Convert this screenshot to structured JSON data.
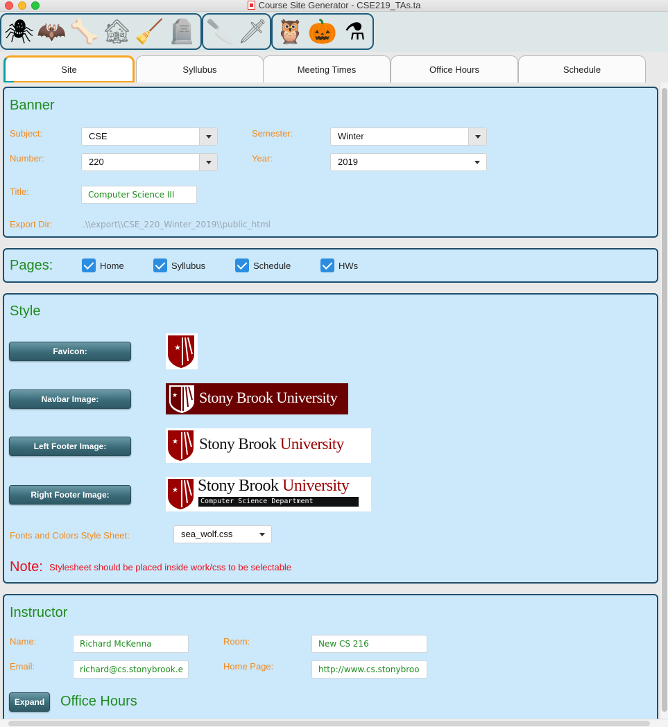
{
  "window": {
    "title": "Course Site Generator - CSE219_TAs.ta"
  },
  "toolbar": {
    "group1": [
      {
        "icon": "spider-icon",
        "glyph": "🕷"
      },
      {
        "icon": "bat-icon",
        "glyph": "🦇"
      },
      {
        "icon": "bones-icon",
        "glyph": "🦴"
      },
      {
        "icon": "haunted-house-icon",
        "glyph": "🏚"
      },
      {
        "icon": "magic-broom-icon",
        "glyph": "🧹"
      },
      {
        "icon": "tombstone-icon",
        "glyph": "🪦"
      }
    ],
    "group2": [
      {
        "icon": "cleaver-icon",
        "glyph": "🔪"
      },
      {
        "icon": "bloody-knife-icon",
        "glyph": "🗡"
      }
    ],
    "group3": [
      {
        "icon": "owl-icon",
        "glyph": "🦉"
      },
      {
        "icon": "pumpkin-icon",
        "glyph": "🎃"
      },
      {
        "icon": "cauldron-icon",
        "glyph": "⚗"
      }
    ]
  },
  "tabs": [
    "Site",
    "Syllubus",
    "Meeting Times",
    "Office Hours",
    "Schedule"
  ],
  "banner": {
    "title": "Banner",
    "subject_label": "Subject:",
    "subject_value": "CSE",
    "semester_label": "Semester:",
    "semester_value": "Winter",
    "number_label": "Number:",
    "number_value": "220",
    "year_label": "Year:",
    "year_value": "2019",
    "title_label": "Title:",
    "title_value": "Computer Science III",
    "export_label": "Export Dir:",
    "export_value": ".\\\\export\\\\CSE_220_Winter_2019\\\\public_html"
  },
  "pages": {
    "title": "Pages:",
    "items": [
      "Home",
      "Syllubus",
      "Schedule",
      "HWs"
    ]
  },
  "style": {
    "title": "Style",
    "favicon_button": "Favicon:",
    "navbar_button": "Navbar Image:",
    "left_footer_button": "Left Footer Image:",
    "right_footer_button": "Right Footer Image:",
    "logo_text_stony": "Stony Brook",
    "logo_text_university": "University",
    "logo_text_dept": "Computer Science Department",
    "colors": {
      "sbu_red": "#990000",
      "navbar_bg": "#6b0000"
    },
    "stylesheet_label": "Fonts and Colors Style Sheet:",
    "stylesheet_value": "sea_wolf.css",
    "note_big": "Note:",
    "note_text": "Stylesheet should be placed inside work/css to be selectable"
  },
  "instructor": {
    "title": "Instructor",
    "name_label": "Name:",
    "name_value": "Richard McKenna",
    "room_label": "Room:",
    "room_value": "New CS 216",
    "email_label": "Email:",
    "email_value": "richard@cs.stonybrook.e",
    "homepage_label": "Home Page:",
    "homepage_value": "http://www.cs.stonybroo",
    "expand_button": "Expand",
    "office_hours_title": "Office Hours"
  }
}
